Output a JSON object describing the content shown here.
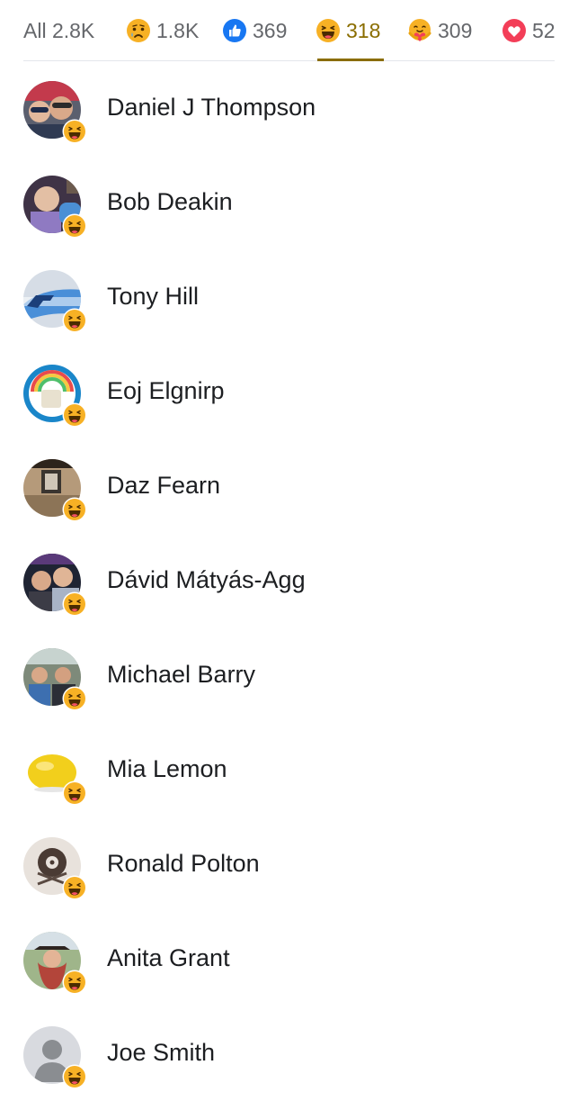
{
  "tabs": [
    {
      "label": "All 2.8K",
      "icon": "none"
    },
    {
      "label": "1.8K",
      "icon": "sad-icon"
    },
    {
      "label": "369",
      "icon": "like-icon"
    },
    {
      "label": "318",
      "icon": "haha-icon",
      "active": true
    },
    {
      "label": "309",
      "icon": "care-icon"
    },
    {
      "label": "52",
      "icon": "love-icon"
    }
  ],
  "colors": {
    "active_tab": "#8a6d00",
    "like_blue": "#1877f2",
    "love_red": "#f33e58",
    "emoji_yellow": "#f7b125"
  },
  "people": [
    {
      "name": "Daniel J Thompson",
      "reaction": "haha-icon"
    },
    {
      "name": "Bob Deakin",
      "reaction": "haha-icon"
    },
    {
      "name": "Tony Hill",
      "reaction": "haha-icon"
    },
    {
      "name": "Eoj Elgnirp",
      "reaction": "haha-icon"
    },
    {
      "name": "Daz Fearn",
      "reaction": "haha-icon"
    },
    {
      "name": "Dávid Mátyás-Agg",
      "reaction": "haha-icon"
    },
    {
      "name": "Michael Barry",
      "reaction": "haha-icon"
    },
    {
      "name": "Mia Lemon",
      "reaction": "haha-icon"
    },
    {
      "name": "Ronald Polton",
      "reaction": "haha-icon"
    },
    {
      "name": "Anita Grant",
      "reaction": "haha-icon"
    },
    {
      "name": "Joe Smith",
      "reaction": "haha-icon"
    }
  ]
}
